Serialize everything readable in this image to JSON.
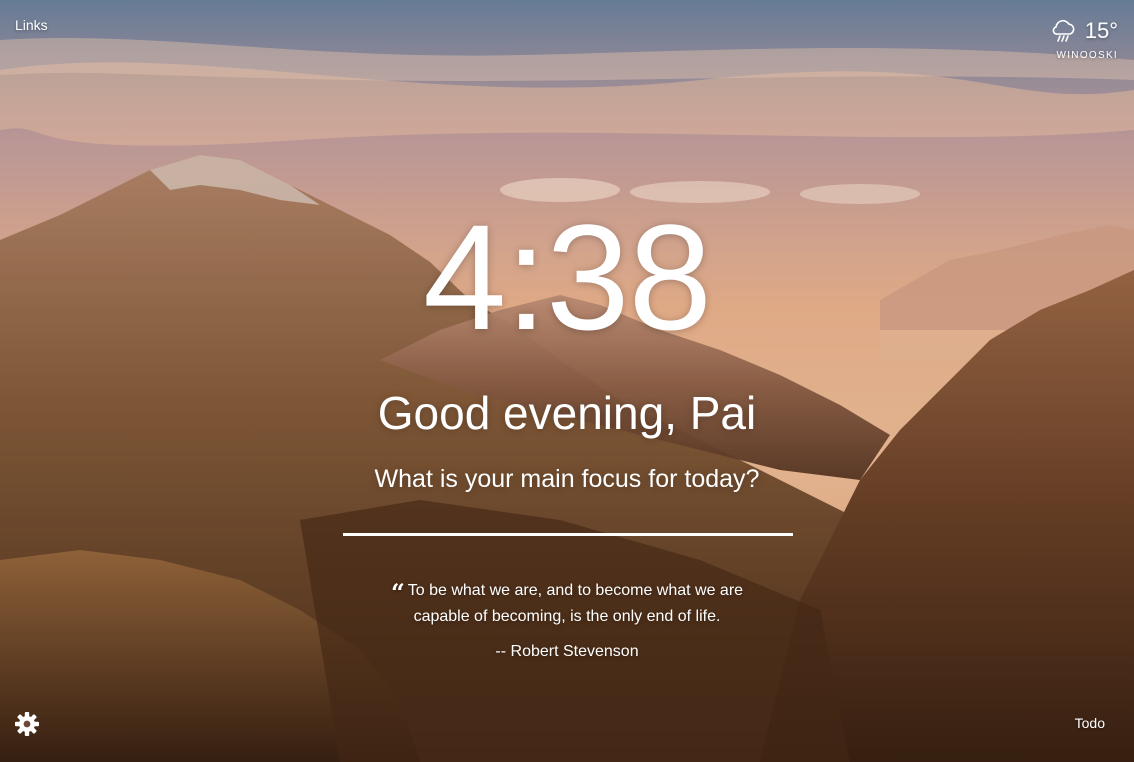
{
  "links_label": "Links",
  "weather": {
    "icon": "rain-cloud-icon",
    "temperature": "15°",
    "location": "WINOOSKI"
  },
  "clock": {
    "time": "4:38"
  },
  "greeting": "Good evening, Pai",
  "focus": {
    "question": "What is your main focus for today?",
    "value": ""
  },
  "quote": {
    "text": "To be what we are, and to become what we are capable of becoming, is the only end of life.",
    "author": "-- Robert Stevenson"
  },
  "settings_icon": "gear-icon",
  "todo_label": "Todo",
  "colors": {
    "text": "#ffffff",
    "sky_top": "#7d8fa8",
    "sunset": "#f1b58f",
    "mountain_dark": "#3a2415"
  }
}
